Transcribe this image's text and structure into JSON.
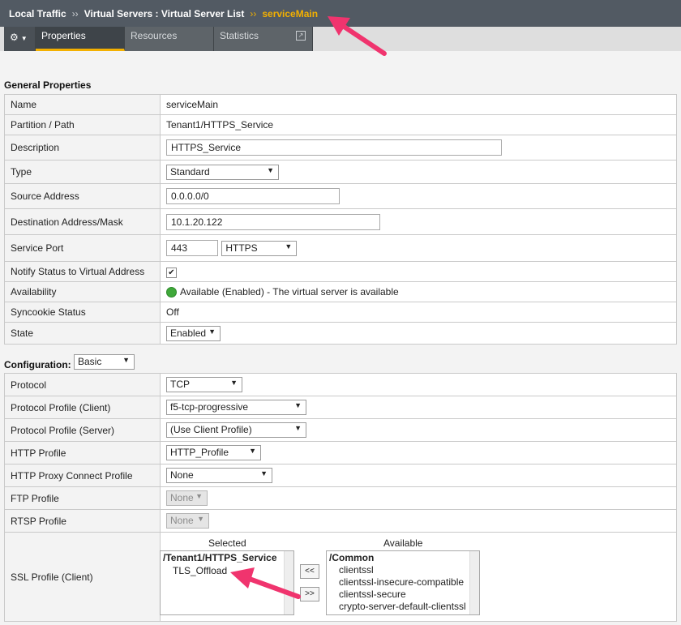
{
  "breadcrumb": {
    "item1": "Local Traffic",
    "item2": "Virtual Servers : Virtual Server List",
    "current": "serviceMain",
    "sep": "››"
  },
  "tabs": {
    "gear_icon": "gear-icon",
    "properties": "Properties",
    "resources": "Resources",
    "statistics": "Statistics"
  },
  "general": {
    "title": "General Properties",
    "rows": {
      "name": {
        "label": "Name",
        "value": "serviceMain"
      },
      "partition": {
        "label": "Partition / Path",
        "value": "Tenant1/HTTPS_Service"
      },
      "description": {
        "label": "Description",
        "value": "HTTPS_Service"
      },
      "type": {
        "label": "Type",
        "value": "Standard"
      },
      "source": {
        "label": "Source Address",
        "value": "0.0.0.0/0"
      },
      "destination": {
        "label": "Destination Address/Mask",
        "value": "10.1.20.122"
      },
      "port": {
        "label": "Service Port",
        "value": "443",
        "protocol": "HTTPS"
      },
      "notify": {
        "label": "Notify Status to Virtual Address",
        "checked": "✔"
      },
      "availability": {
        "label": "Availability",
        "value": "Available (Enabled) - The virtual server is available"
      },
      "syncookie": {
        "label": "Syncookie Status",
        "value": "Off"
      },
      "state": {
        "label": "State",
        "value": "Enabled"
      }
    }
  },
  "configuration": {
    "title": "Configuration:",
    "mode": "Basic",
    "rows": {
      "protocol": {
        "label": "Protocol",
        "value": "TCP"
      },
      "client_profile": {
        "label": "Protocol Profile (Client)",
        "value": "f5-tcp-progressive"
      },
      "server_profile": {
        "label": "Protocol Profile (Server)",
        "value": "(Use Client Profile)"
      },
      "http_profile": {
        "label": "HTTP Profile",
        "value": "HTTP_Profile"
      },
      "http_proxy": {
        "label": "HTTP Proxy Connect Profile",
        "value": "None"
      },
      "ftp": {
        "label": "FTP Profile",
        "value": "None"
      },
      "rtsp": {
        "label": "RTSP Profile",
        "value": "None"
      },
      "ssl_client": {
        "label": "SSL Profile (Client)",
        "selected_header": "Selected",
        "available_header": "Available",
        "selected_group": "/Tenant1/HTTPS_Service",
        "selected_items": [
          "TLS_Offload"
        ],
        "available_group": "/Common",
        "available_items": [
          "clientssl",
          "clientssl-insecure-compatible",
          "clientssl-secure",
          "crypto-server-default-clientssl"
        ],
        "move_left": "<<",
        "move_right": ">>"
      }
    }
  },
  "colors": {
    "accent": "#f3b000",
    "annotation": "#f0346e",
    "header_bg": "#525a63"
  }
}
